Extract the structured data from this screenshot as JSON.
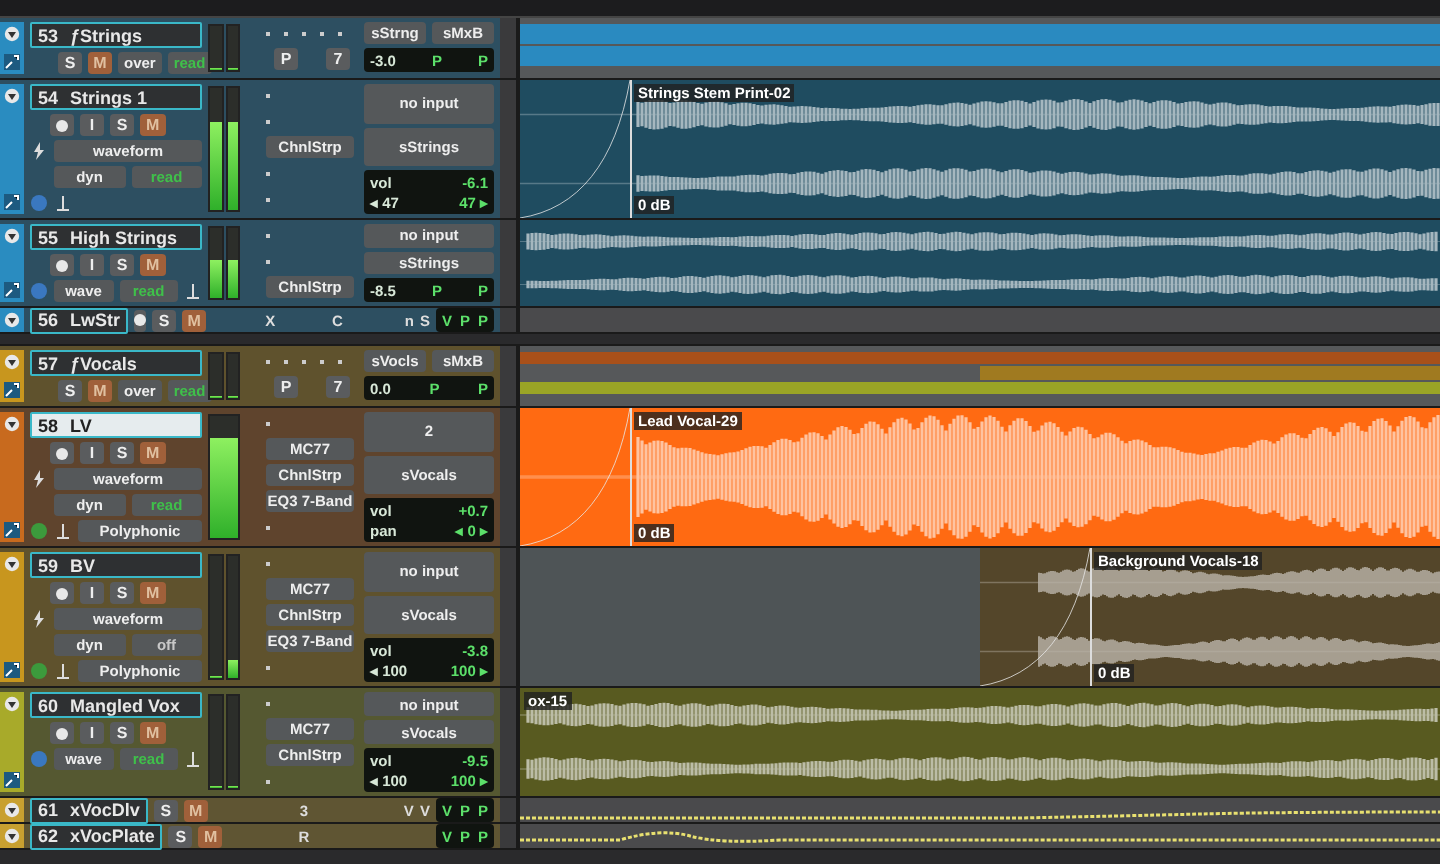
{
  "tracks": [
    {
      "kind": "folder",
      "number": "53",
      "name": "ƒStrings",
      "color": "#2a8cc0",
      "buttons": [
        "S",
        "M"
      ],
      "mode": "over",
      "automation": {
        "label": "read",
        "active": true
      },
      "extras": [
        "P",
        "7"
      ],
      "sends": [
        "sStrng",
        "sMxB"
      ],
      "readout": [
        "-3.0",
        "P",
        "P"
      ],
      "meters": [
        {
          "level": 0
        },
        {
          "level": 0
        }
      ],
      "bands": [
        {
          "color": "#2a8ac0",
          "lead_in": false
        },
        {
          "color": "#2a8ac0",
          "lead_in": false
        }
      ]
    },
    {
      "kind": "audio",
      "number": "54",
      "name": "Strings 1",
      "selected": false,
      "color": "#2a8cc0",
      "buttons": [
        {
          "kind": "record"
        },
        {
          "kind": "input",
          "label": "I"
        },
        {
          "kind": "solo",
          "label": "S"
        },
        {
          "kind": "mute",
          "label": "M"
        }
      ],
      "view": "waveform",
      "dyn": "dyn",
      "automation": {
        "label": "read",
        "active": true
      },
      "inserts": [
        {
          "kind": "empty"
        },
        {
          "kind": "empty"
        },
        {
          "kind": "plugin",
          "name": "ChnlStrp"
        },
        {
          "kind": "empty"
        },
        {
          "kind": "empty"
        }
      ],
      "input": "no input",
      "output": "sStrings",
      "readout": [
        [
          "vol",
          "-6.1"
        ],
        [
          "◂ 47",
          "47 ▸"
        ]
      ],
      "meters": [
        {
          "level": 0.72
        },
        {
          "level": 0.72
        }
      ],
      "stereo": true,
      "clip": {
        "name": "Strings Stem Print-02",
        "gain": "0 dB",
        "lead_in": false,
        "fade": true,
        "color": "#1f4c60"
      }
    },
    {
      "kind": "compact",
      "number": "55",
      "name": "High Strings",
      "selected": false,
      "color": "#2a8cc0",
      "buttons": [
        {
          "kind": "record"
        },
        {
          "kind": "input",
          "label": "I"
        },
        {
          "kind": "solo",
          "label": "S"
        },
        {
          "kind": "mute",
          "label": "M"
        }
      ],
      "view": "wave",
      "automation": {
        "label": "read",
        "active": true
      },
      "inserts": [
        {
          "kind": "empty"
        },
        {
          "kind": "empty"
        },
        {
          "kind": "plugin",
          "name": "ChnlStrp"
        }
      ],
      "input": "no input",
      "output": "sStrings",
      "readout": [
        [
          "-8.5",
          "P",
          "P"
        ]
      ],
      "meters": [
        {
          "level": 0.55
        },
        {
          "level": 0.55
        }
      ],
      "stereo": true,
      "clip": {
        "lead_in": false,
        "fade": false,
        "color": "#1f4c60"
      }
    },
    {
      "kind": "mini",
      "number": "56",
      "name": "LwStr",
      "color": "#2a8cc0",
      "record": true,
      "buttons": [
        "S",
        "M"
      ],
      "inserts": [
        "X",
        "C"
      ],
      "sends": [
        "n",
        "S"
      ],
      "readout": [
        "V",
        "P",
        "P"
      ],
      "automation_line": false
    },
    {
      "kind": "folder",
      "number": "57",
      "name": "ƒVocals",
      "color": "#c8961e",
      "buttons": [
        "S",
        "M"
      ],
      "mode": "over",
      "automation": {
        "label": "read",
        "active": true
      },
      "extras": [
        "P",
        "7"
      ],
      "sends": [
        "sVocls",
        "sMxB"
      ],
      "readout": [
        "0.0",
        "P",
        "P"
      ],
      "meters": [
        {
          "level": 0
        },
        {
          "level": 0
        }
      ],
      "bands": [
        {
          "color": "#a8501a",
          "lead_in": false
        },
        {
          "color": "#a07a20",
          "lead_in": true
        },
        {
          "color": "#9aa426",
          "lead_in": false
        }
      ]
    },
    {
      "kind": "audio",
      "number": "58",
      "name": "LV",
      "selected": true,
      "color": "#c86a1e",
      "buttons": [
        {
          "kind": "record"
        },
        {
          "kind": "input",
          "label": "I"
        },
        {
          "kind": "solo",
          "label": "S"
        },
        {
          "kind": "mute",
          "label": "M"
        }
      ],
      "view": "waveform",
      "dyn": "dyn",
      "automation": {
        "label": "read",
        "active": true
      },
      "elastic": "Polyphonic",
      "inserts": [
        {
          "kind": "empty"
        },
        {
          "kind": "plugin",
          "name": "MC77"
        },
        {
          "kind": "plugin",
          "name": "ChnlStrp"
        },
        {
          "kind": "plugin",
          "name": "EQ3 7-Band"
        },
        {
          "kind": "empty"
        }
      ],
      "input": "2",
      "output": "sVocals",
      "readout": [
        [
          "vol",
          "+0.7"
        ],
        [
          "pan",
          "◂ 0 ▸"
        ]
      ],
      "meters": [
        {
          "level": 0.82
        }
      ],
      "stereo": false,
      "clip": {
        "name": "Lead Vocal-29",
        "gain": "0 dB",
        "lead_in": false,
        "fade": true,
        "color": "#ff6a12"
      }
    },
    {
      "kind": "audio",
      "number": "59",
      "name": "BV",
      "selected": false,
      "color": "#c8961e",
      "buttons": [
        {
          "kind": "record"
        },
        {
          "kind": "input",
          "label": "I"
        },
        {
          "kind": "solo",
          "label": "S"
        },
        {
          "kind": "mute",
          "label": "M"
        }
      ],
      "view": "waveform",
      "dyn": "dyn",
      "automation": {
        "label": "off",
        "active": false
      },
      "elastic": "Polyphonic",
      "inserts": [
        {
          "kind": "empty"
        },
        {
          "kind": "plugin",
          "name": "MC77"
        },
        {
          "kind": "plugin",
          "name": "ChnlStrp"
        },
        {
          "kind": "plugin",
          "name": "EQ3 7-Band"
        },
        {
          "kind": "empty"
        }
      ],
      "input": "no input",
      "output": "sVocals",
      "readout": [
        [
          "vol",
          "-3.8"
        ],
        [
          "◂ 100",
          "100 ▸"
        ]
      ],
      "meters": [
        {
          "level": 0
        },
        {
          "level": 0.15
        }
      ],
      "stereo": true,
      "clip": {
        "name": "Background Vocals-18",
        "gain": "0 dB",
        "lead_in": true,
        "fade": true,
        "color": "#54462a"
      }
    },
    {
      "kind": "compact",
      "number": "60",
      "name": "Mangled Vox",
      "selected": false,
      "color": "#a8aa2a",
      "buttons": [
        {
          "kind": "record"
        },
        {
          "kind": "input",
          "label": "I"
        },
        {
          "kind": "solo",
          "label": "S"
        },
        {
          "kind": "mute",
          "label": "M"
        }
      ],
      "view": "wave",
      "automation": {
        "label": "read",
        "active": true
      },
      "inserts": [
        {
          "kind": "empty"
        },
        {
          "kind": "plugin",
          "name": "MC77"
        },
        {
          "kind": "plugin",
          "name": "ChnlStrp"
        },
        {
          "kind": "empty"
        }
      ],
      "input": "no input",
      "output": "sVocals",
      "readout": [
        [
          "vol",
          "-9.5"
        ],
        [
          "◂ 100",
          "100 ▸"
        ]
      ],
      "meters": [
        {
          "level": 0
        },
        {
          "level": 0
        }
      ],
      "stereo": true,
      "clip": {
        "name": "ox-15",
        "lead_in": false,
        "fade": false,
        "color": "#585a20"
      }
    },
    {
      "kind": "mini",
      "number": "61",
      "name": "xVocDlv",
      "color": "#c8a030",
      "record": false,
      "buttons": [
        "S",
        "M"
      ],
      "inserts": [
        "3"
      ],
      "sends": [
        "V",
        "V"
      ],
      "readout": [
        "V",
        "P",
        "P"
      ],
      "automation_line": true
    },
    {
      "kind": "mini",
      "number": "62",
      "name": "xVocPlate",
      "color": "#c8a030",
      "record": false,
      "buttons": [
        "S",
        "M"
      ],
      "inserts": [
        "R"
      ],
      "readout": [
        "V",
        "P",
        "P"
      ],
      "automation_line": true
    }
  ]
}
